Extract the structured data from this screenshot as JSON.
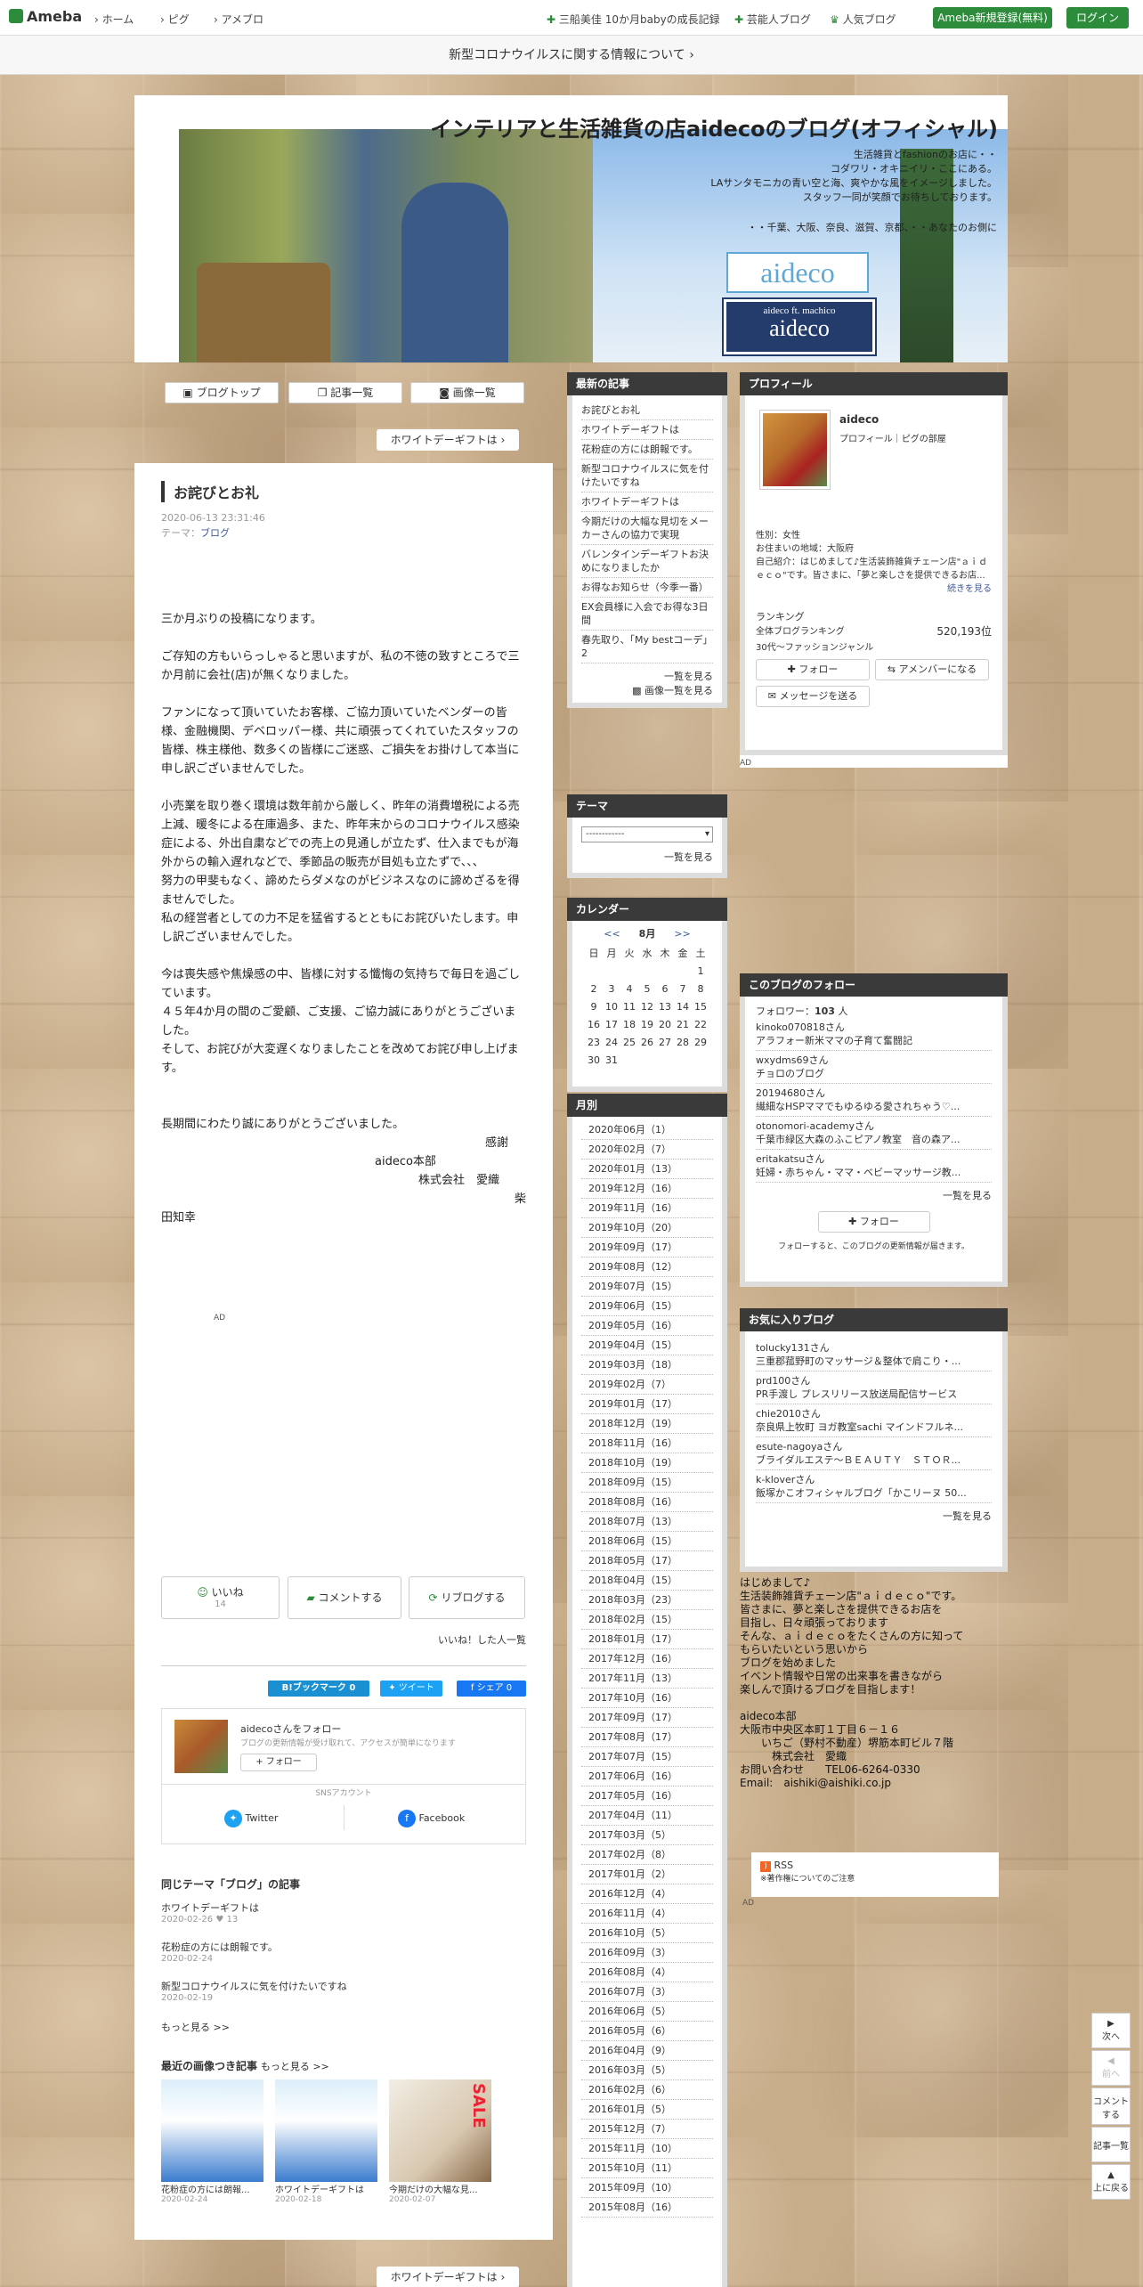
{
  "topbar": {
    "logo": "Ameba",
    "nav": [
      "ホーム",
      "ピグ",
      "アメブロ"
    ],
    "right": [
      "三船美佳 10か月babyの成長記録",
      "芸能人ブログ",
      "人気ブログ"
    ],
    "signup": "Ameba新規登録(無料)",
    "login": "ログイン"
  },
  "notice": "新型コロナウイルスに関する情報について",
  "header": {
    "title": "インテリアと生活雑貨の店aidecoのブログ(オフィシャル)",
    "desc1": "生活雑貨とfashionのお店に・・",
    "desc2": "コダワリ・オキニイリ・ここにある。",
    "desc3": "LAサンタモニカの青い空と海、爽やかな風をイメージしました。",
    "desc4": "スタッフ一同が笑顔でお待ちしております。",
    "desc5": "・・千葉、大阪、奈良、滋賀、京都、・・あなたのお側に",
    "logo1": "aideco",
    "logo2_small": "aideco ft. machico",
    "logo2": "aideco"
  },
  "tabs": {
    "top": "ブログトップ",
    "list": "記事一覧",
    "images": "画像一覧"
  },
  "next_article": "ホワイトデーギフトは",
  "article": {
    "title": "お詫びとお礼",
    "date": "2020-06-13 23:31:46",
    "theme_label": "テーマ：",
    "theme": "ブログ",
    "p1": "三か月ぶりの投稿になります。",
    "p2": "ご存知の方もいらっしゃると思いますが、私の不徳の致すところで三か月前に会社(店)が無くなりました。",
    "p3": "ファンになって頂いていたお客様、ご協力頂いていたベンダーの皆様、金融機関、デベロッパー様、共に頑張ってくれていたスタッフの皆様、株主様他、数多くの皆様にご迷惑、ご損失をお掛けして本当に申し訳ございませんでした。",
    "p4": "小売業を取り巻く環境は数年前から厳しく、昨年の消費増税による売上減、暖冬による在庫過多、また、昨年末からのコロナウイルス感染症による、外出自粛などでの売上の見通しが立たず、仕入までもが海外からの輸入遅れなどで、季節品の販売が目処も立たずで、、、",
    "p5": "努力の甲斐もなく、諦めたらダメなのがビジネスなのに諦めざるを得ませんでした。",
    "p6": "私の経営者としての力不足を猛省するとともにお詫びいたします。申し訳ございませんでした。",
    "p7": "今は喪失感や焦燥感の中、皆様に対する懺悔の気持ちで毎日を過ごしています。",
    "p8": "４５年4か月の間のご愛顧、ご支援、ご協力誠にありがとうございました。",
    "p9": "そして、お詫びが大変遅くなりましたことを改めてお詫び申し上げます。",
    "p10": "長期間にわたり誠にありがとうございました。",
    "sig1": "感謝",
    "sig2": "aideco本部",
    "sig3": "株式会社　愛織",
    "sig4": "柴",
    "sig5": "田知幸",
    "ad": "AD",
    "like": "いいね",
    "like_count": "14",
    "comment": "コメントする",
    "reblog": "リブログする",
    "liked_people": "いいね！した人一覧",
    "hatena": "B!ブックマーク",
    "hatena_count": "0",
    "tweet": "ツイート",
    "fb_share": "シェア",
    "fb_count": "0",
    "follow_name": "aidecoさんをフォロー",
    "follow_desc": "ブログの更新情報が受け取れて、アクセスが簡単になります",
    "follow_btn": "フォロー",
    "sns": "SNSアカウント",
    "twitter": "Twitter",
    "facebook": "Facebook",
    "same_theme": "同じテーマ「ブログ」の記事",
    "related": [
      {
        "title": "ホワイトデーギフトは",
        "date": "2020-02-26",
        "count": "13"
      },
      {
        "title": "花粉症の方には朗報です。",
        "date": "2020-02-24"
      },
      {
        "title": "新型コロナウイルスに気を付けたいですね",
        "date": "2020-02-19"
      }
    ],
    "more": "もっと見る >>",
    "recent_img": "最近の画像つき記事",
    "recent_more": "もっと見る >>",
    "thumbs": [
      {
        "title": "花粉症の方には朗報...",
        "date": "2020-02-24"
      },
      {
        "title": "ホワイトデーギフトは",
        "date": "2020-02-18"
      },
      {
        "title": "今期だけの大幅な見...",
        "date": "2020-02-07"
      }
    ]
  },
  "latest": {
    "head": "最新の記事",
    "items": [
      "お詫びとお礼",
      "ホワイトデーギフトは",
      "花粉症の方には朗報です。",
      "新型コロナウイルスに気を付けたいですね",
      "ホワイトデーギフトは",
      "今期だけの大幅な見切をメーカーさんの協力で実現",
      "バレンタインデーギフトお決めになりましたか",
      "お得なお知らせ（今季一番）",
      "EX会員様に入会でお得な3日間",
      "春先取り、「My bestコーデ」2"
    ],
    "more": "一覧を見る",
    "img_more": "画像一覧を見る"
  },
  "theme": {
    "head": "テーマ",
    "select": "------------",
    "more": "一覧を見る"
  },
  "calendar": {
    "head": "カレンダー",
    "prev": "<<",
    "month": "8月",
    "next": ">>",
    "dow": [
      "日",
      "月",
      "火",
      "水",
      "木",
      "金",
      "土"
    ],
    "weeks": [
      [
        "",
        "",
        "",
        "",
        "",
        "",
        "1"
      ],
      [
        "2",
        "3",
        "4",
        "5",
        "6",
        "7",
        "8"
      ],
      [
        "9",
        "10",
        "11",
        "12",
        "13",
        "14",
        "15"
      ],
      [
        "16",
        "17",
        "18",
        "19",
        "20",
        "21",
        "22"
      ],
      [
        "23",
        "24",
        "25",
        "26",
        "27",
        "28",
        "29"
      ],
      [
        "30",
        "31",
        "",
        "",
        "",
        "",
        ""
      ]
    ]
  },
  "monthly": {
    "head": "月別",
    "items": [
      "2020年06月（1）",
      "2020年02月（7）",
      "2020年01月（13）",
      "2019年12月（16）",
      "2019年11月（16）",
      "2019年10月（20）",
      "2019年09月（17）",
      "2019年08月（12）",
      "2019年07月（15）",
      "2019年06月（15）",
      "2019年05月（16）",
      "2019年04月（15）",
      "2019年03月（18）",
      "2019年02月（7）",
      "2019年01月（17）",
      "2018年12月（19）",
      "2018年11月（16）",
      "2018年10月（19）",
      "2018年09月（15）",
      "2018年08月（16）",
      "2018年07月（13）",
      "2018年06月（15）",
      "2018年05月（17）",
      "2018年04月（15）",
      "2018年03月（23）",
      "2018年02月（15）",
      "2018年01月（17）",
      "2017年12月（16）",
      "2017年11月（13）",
      "2017年10月（16）",
      "2017年09月（17）",
      "2017年08月（17）",
      "2017年07月（15）",
      "2017年06月（16）",
      "2017年05月（16）",
      "2017年04月（11）",
      "2017年03月（5）",
      "2017年02月（8）",
      "2017年01月（2）",
      "2016年12月（4）",
      "2016年11月（4）",
      "2016年10月（5）",
      "2016年09月（3）",
      "2016年08月（4）",
      "2016年07月（3）",
      "2016年06月（5）",
      "2016年05月（6）",
      "2016年04月（9）",
      "2016年03月（5）",
      "2016年02月（6）",
      "2016年01月（5）",
      "2015年12月（7）",
      "2015年11月（10）",
      "2015年10月（11）",
      "2015年09月（10）",
      "2015年08月（16）"
    ]
  },
  "profile": {
    "head": "プロフィール",
    "name": "aideco",
    "links": "プロフィール｜ピグの部屋",
    "gender": "性別：女性",
    "area": "お住まいの地域：大阪府",
    "intro": "自己紹介：はじめまして♪生活装飾雑貨チェーン店\"ａｉｄｅｃｏ\"です。皆さまに、「夢と楽しさを提供できるお店...",
    "cont": "続きを見る",
    "rank": "ランキング",
    "rank_all": "全体ブログランキング",
    "rank_num": "520,193位",
    "rank_genre": "30代〜ファッションジャンル",
    "follow": "フォロー",
    "amember": "アメンバーになる",
    "message": "メッセージを送る",
    "ad": "AD"
  },
  "followers": {
    "head": "このブログのフォロー",
    "count_label": "フォロワー：",
    "count": "103",
    "unit": "人",
    "items": [
      {
        "n": "kinoko070818さん",
        "d": "アラフォー新米ママの子育て奮闘記"
      },
      {
        "n": "wxydms69さん",
        "d": "チョロのブログ"
      },
      {
        "n": "20194680さん",
        "d": "繊細なHSPママでもゆるゆる愛されちゃう♡..."
      },
      {
        "n": "otonomori-academyさん",
        "d": "千葉市緑区大森のふこピアノ教室　音の森ア..."
      },
      {
        "n": "eritakatsuさん",
        "d": "妊婦・赤ちゃん・ママ・ベビーマッサージ教..."
      }
    ],
    "more": "一覧を見る",
    "follow": "フォロー",
    "note": "フォローすると、このブログの更新情報が届きます。"
  },
  "favorites": {
    "head": "お気に入りブログ",
    "items": [
      {
        "n": "tolucky131さん",
        "d": "三重郡菰野町のマッサージ＆整体で肩こり・..."
      },
      {
        "n": "prd100さん",
        "d": "PR手渡し プレスリリース放送局配信サービス"
      },
      {
        "n": "chie2010さん",
        "d": "奈良県上牧町 ヨガ教室sachi マインドフルネ..."
      },
      {
        "n": "esute-nagoyaさん",
        "d": "ブライダルエステ～ＢＥＡＵＴＹ　ＳＴＯＲ..."
      },
      {
        "n": "k-kloverさん",
        "d": "飯塚かこオフィシャルブログ「かこリーヌ 50..."
      }
    ],
    "more": "一覧を見る"
  },
  "freetext": [
    "はじめまして♪",
    "生活装飾雑貨チェーン店\"ａｉｄｅｃｏ\"です。",
    "皆さまに、夢と楽しさを提供できるお店を",
    "目指し、日々頑張っております",
    "そんな、ａｉｄｅｃｏをたくさんの方に知って",
    "もらいたいという思いから",
    "ブログを始めました",
    "イベント情報や日常の出来事を書きながら",
    "楽しんで頂けるブログを目指します！",
    "",
    "aideco本部",
    "大阪市中央区本町１丁目６－１６",
    "　　いちご（野村不動産）堺筋本町ビル７階",
    "　　　株式会社　愛織",
    "お問い合わせ　　TEL06-6264-0330",
    "Email:　aishiki@aishiki.co.jp"
  ],
  "rss": {
    "label": "RSS",
    "note": "※著作権についてのご注意",
    "ad": "AD"
  },
  "float": {
    "next": "次へ",
    "prev": "前へ",
    "comment": "コメントする",
    "list": "記事一覧",
    "top": "上に戻る"
  }
}
